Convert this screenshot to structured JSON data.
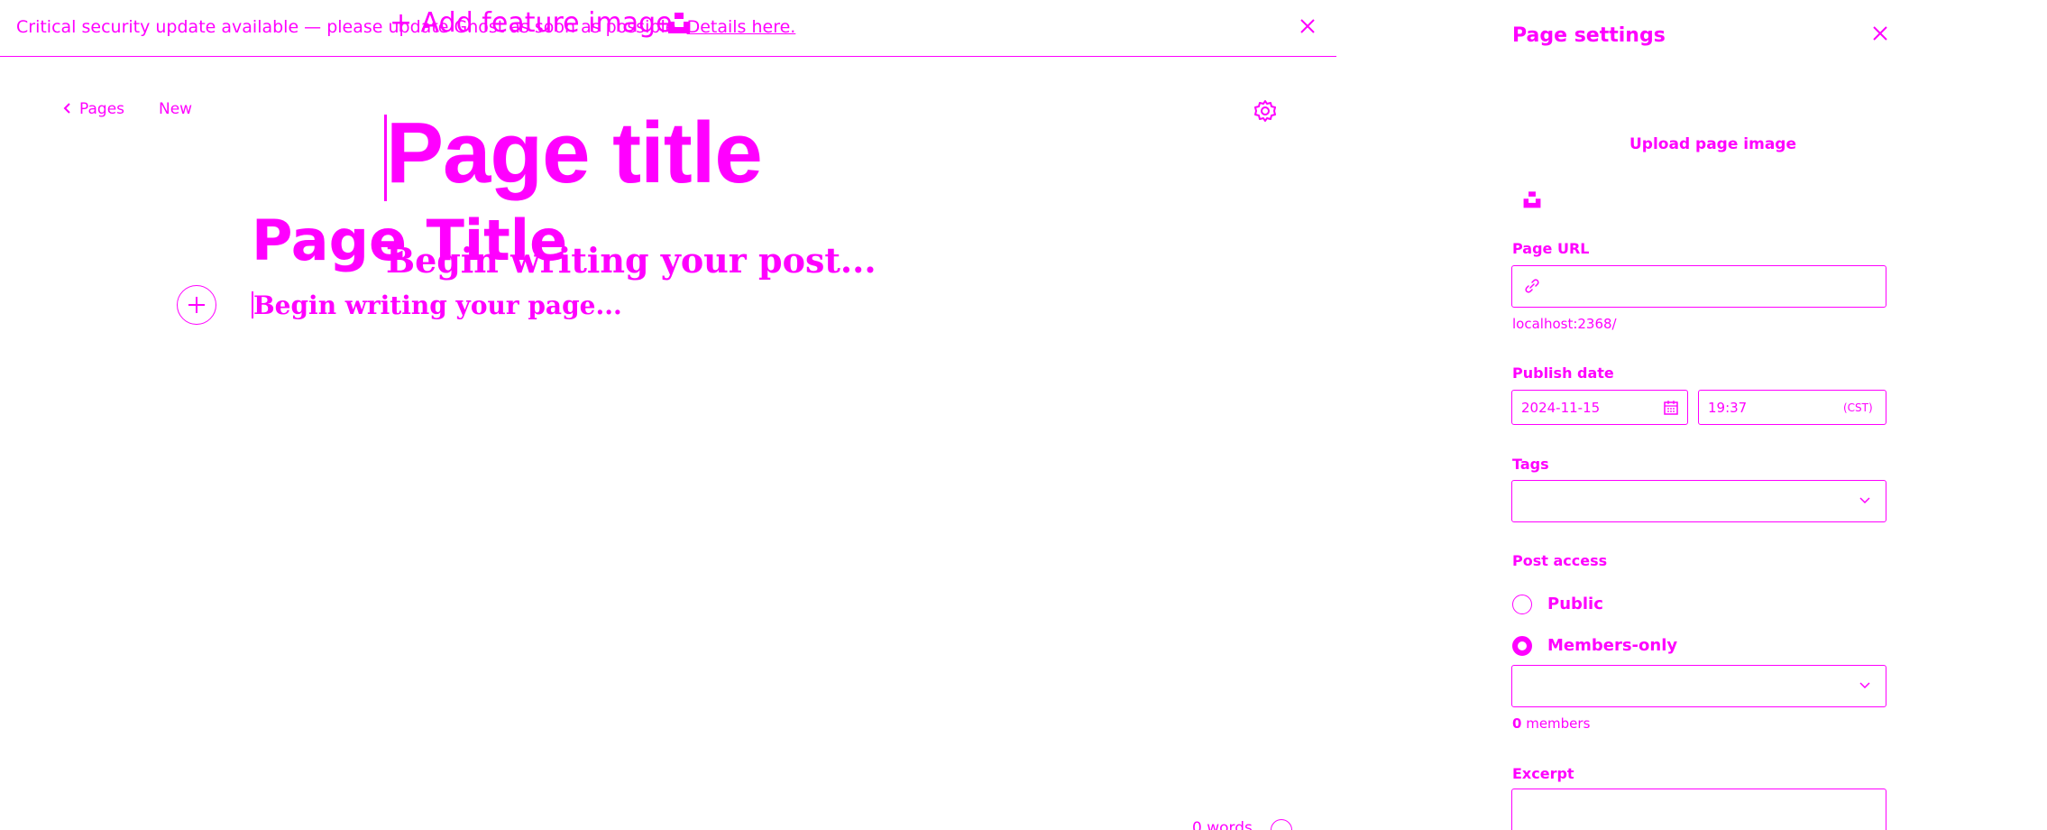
{
  "banner": {
    "message": "Critical security update available — please update Ghost as soon as possible.",
    "link_text": "Details here."
  },
  "editor": {
    "add_feature_image": "+ Add feature image",
    "breadcrumb": "Pages",
    "status": "New",
    "title_value": "Page title",
    "title_placeholder": "Page Title",
    "post_placeholder": "Begin writing your post...",
    "body_placeholder": "Begin writing your page...",
    "word_count": "0 words"
  },
  "settings": {
    "title": "Page settings",
    "upload_image": "Upload page image",
    "url": {
      "label": "Page URL",
      "value": "",
      "hint": "localhost:2368/"
    },
    "publish": {
      "label": "Publish date",
      "date": "2024-11-15",
      "time": "19:37",
      "timezone": "(CST)"
    },
    "tags": {
      "label": "Tags",
      "value": ""
    },
    "access": {
      "label": "Post access",
      "options": [
        "Public",
        "Members-only"
      ],
      "selected": "Members-only",
      "member_count": "0",
      "member_suffix": " members"
    },
    "excerpt": {
      "label": "Excerpt",
      "value": ""
    }
  },
  "colors": {
    "accent": "#ff00ff",
    "background": "#ffffff"
  },
  "icons": [
    "close-icon",
    "unsplash-icon",
    "chevron-left-icon",
    "gear-icon",
    "plus-icon",
    "link-icon",
    "calendar-icon",
    "chevron-down-icon",
    "help-icon"
  ]
}
